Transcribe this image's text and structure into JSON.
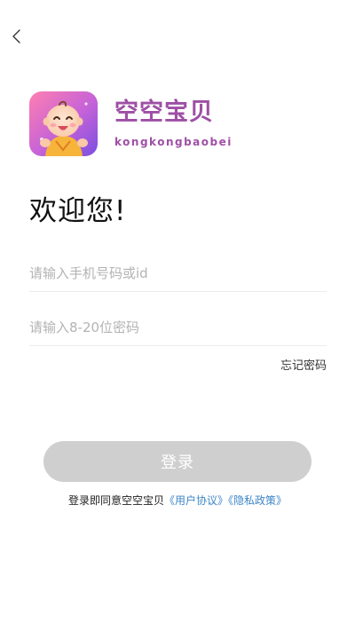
{
  "brand": {
    "name": "空空宝贝",
    "pinyin": "kongkongbaobei"
  },
  "welcome": "欢迎您!",
  "form": {
    "phone_placeholder": "请输入手机号码或id",
    "password_placeholder": "请输入8-20位密码",
    "forgot_label": "忘记密码"
  },
  "login_label": "登录",
  "agreement": {
    "prefix": "登录即同意空空宝贝",
    "user_agreement": "《用户协议》",
    "privacy_policy": "《隐私政策》"
  },
  "icons": {
    "back": "chevron-left-icon",
    "logo": "baby-mascot-logo"
  },
  "colors": {
    "brand": "#9e4fa5",
    "link": "#3d86c6",
    "button_disabled": "#cfcfcf"
  }
}
